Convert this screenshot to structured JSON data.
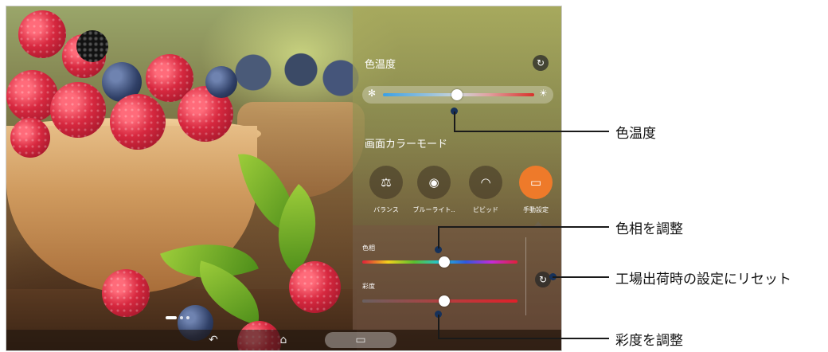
{
  "panel": {
    "title": "色温度",
    "mode_title": "画面カラーモード",
    "modes": [
      {
        "label": "バランス",
        "icon": "balance-scale-icon"
      },
      {
        "label": "ブルーライト..",
        "icon": "eye-shield-icon"
      },
      {
        "label": "ビビッド",
        "icon": "vivid-rainbow-icon"
      },
      {
        "label": "手動設定",
        "icon": "manual-settings-icon",
        "active": true
      }
    ],
    "hue_label": "色相",
    "saturation_label": "彩度",
    "accent_color": "#ee7a2a",
    "temperature_icons": {
      "cool": "snowflake-icon",
      "warm": "sun-icon"
    }
  },
  "callouts": {
    "color_temperature": "色温度",
    "hue": "色相を調整",
    "reset": "工場出荷時の設定にリセット",
    "saturation": "彩度を調整"
  },
  "nav": {
    "back": "back-icon",
    "home": "home-icon",
    "recent": "recent-apps-icon"
  }
}
